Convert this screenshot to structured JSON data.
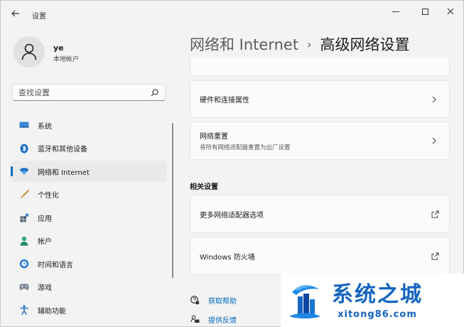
{
  "window": {
    "title": "设置"
  },
  "user": {
    "name": "ye",
    "account_type": "本地帐户"
  },
  "search": {
    "placeholder": "查找设置"
  },
  "sidebar": {
    "items": [
      {
        "label": "系统",
        "icon": "monitor-icon"
      },
      {
        "label": "蓝牙和其他设备",
        "icon": "bluetooth-icon"
      },
      {
        "label": "网络和 Internet",
        "icon": "wifi-icon",
        "active": true
      },
      {
        "label": "个性化",
        "icon": "brush-icon"
      },
      {
        "label": "应用",
        "icon": "apps-icon"
      },
      {
        "label": "帐户",
        "icon": "person-icon"
      },
      {
        "label": "时间和语言",
        "icon": "globe-clock-icon"
      },
      {
        "label": "游戏",
        "icon": "gamepad-icon"
      },
      {
        "label": "辅助功能",
        "icon": "accessibility-icon"
      }
    ]
  },
  "breadcrumb": {
    "parent": "网络和 Internet",
    "separator": "›",
    "current": "高级网络设置"
  },
  "cards": {
    "hardware": {
      "title": "硬件和连接属性"
    },
    "reset": {
      "title": "网络重置",
      "subtitle": "将所有网络适配器重置为出厂设置"
    }
  },
  "related": {
    "title": "相关设置",
    "items": [
      {
        "title": "更多网络适配器选项"
      },
      {
        "title": "Windows 防火墙"
      }
    ]
  },
  "help": {
    "get_help": "获取帮助",
    "feedback": "提供反馈"
  },
  "watermark": {
    "brand": "系统之城",
    "url": "xitong86.com"
  },
  "colors": {
    "accent": "#0067c0",
    "watermark_blue": "#1565c0",
    "background": "#f3f3f3",
    "card": "#fbfbfb"
  }
}
